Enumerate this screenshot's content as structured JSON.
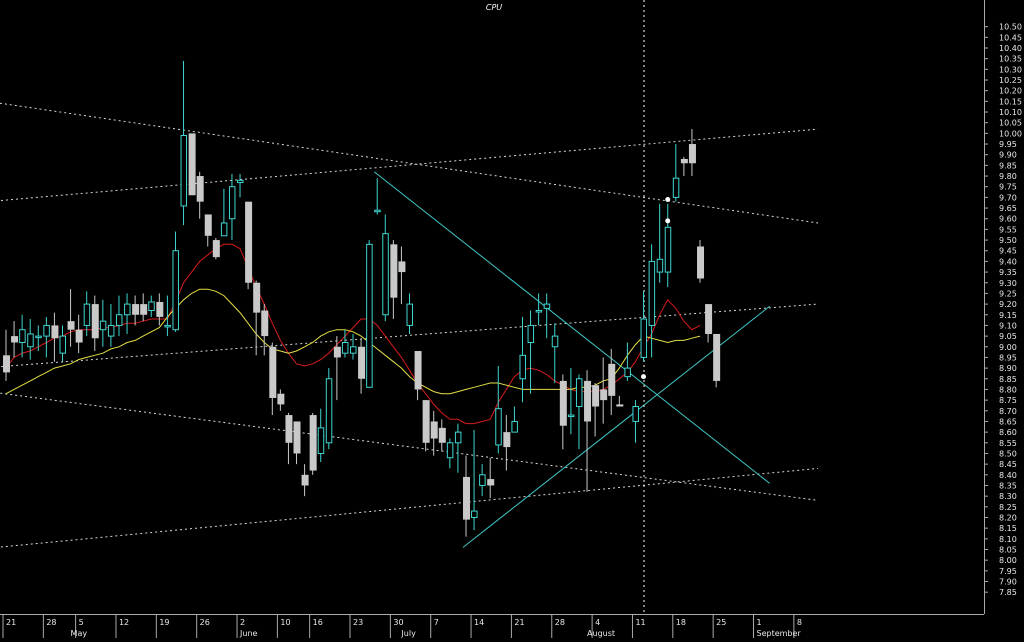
{
  "chart_data": {
    "type": "candlestick",
    "title": "CPU",
    "xlabel": "",
    "ylabel": "",
    "ylim": [
      7.8,
      10.55
    ],
    "y_ticks": [
      "7.85",
      "7.90",
      "7.95",
      "8.00",
      "8.05",
      "8.10",
      "8.15",
      "8.20",
      "8.25",
      "8.30",
      "8.35",
      "8.40",
      "8.45",
      "8.50",
      "8.55",
      "8.60",
      "8.65",
      "8.70",
      "8.75",
      "8.80",
      "8.85",
      "8.90",
      "8.95",
      "9.00",
      "9.05",
      "9.10",
      "9.15",
      "9.20",
      "9.25",
      "9.30",
      "9.35",
      "9.40",
      "9.45",
      "9.50",
      "9.55",
      "9.60",
      "9.65",
      "9.70",
      "9.75",
      "9.80",
      "9.85",
      "9.90",
      "9.95",
      "10.00",
      "10.05",
      "10.10",
      "10.15",
      "10.20",
      "10.25",
      "10.30",
      "10.35",
      "10.40",
      "10.45",
      "10.50"
    ],
    "x_day_ticks": [
      {
        "i": 0,
        "label": "21"
      },
      {
        "i": 5,
        "label": "28"
      },
      {
        "i": 9,
        "label": "5"
      },
      {
        "i": 14,
        "label": "12"
      },
      {
        "i": 19,
        "label": "19"
      },
      {
        "i": 24,
        "label": "26"
      },
      {
        "i": 29,
        "label": "2"
      },
      {
        "i": 34,
        "label": "10"
      },
      {
        "i": 38,
        "label": "16"
      },
      {
        "i": 43,
        "label": "23"
      },
      {
        "i": 48,
        "label": "30"
      },
      {
        "i": 53,
        "label": "7"
      },
      {
        "i": 58,
        "label": "14"
      },
      {
        "i": 63,
        "label": "21"
      },
      {
        "i": 68,
        "label": "28"
      },
      {
        "i": 73,
        "label": "4"
      },
      {
        "i": 78,
        "label": "11"
      },
      {
        "i": 83,
        "label": "18"
      },
      {
        "i": 88,
        "label": "25"
      },
      {
        "i": 93,
        "label": "1"
      },
      {
        "i": 98,
        "label": "8"
      }
    ],
    "x_month_ticks": [
      {
        "i": 8,
        "label": "May"
      },
      {
        "i": 29,
        "label": "June"
      },
      {
        "i": 49,
        "label": "July"
      },
      {
        "i": 72,
        "label": "August"
      },
      {
        "i": 93,
        "label": "September"
      }
    ],
    "cursor_index": 79,
    "candles": [
      [
        8.96,
        8.88,
        9.08,
        8.84
      ],
      [
        9.05,
        9.02,
        9.12,
        8.95
      ],
      [
        9.02,
        9.08,
        9.15,
        8.95
      ],
      [
        9.0,
        9.06,
        9.13,
        8.94
      ],
      [
        9.05,
        9.05,
        9.1,
        8.98
      ],
      [
        9.05,
        9.1,
        9.14,
        8.95
      ],
      [
        9.1,
        9.04,
        9.16,
        8.93
      ],
      [
        8.97,
        9.05,
        9.1,
        8.93
      ],
      [
        9.12,
        9.08,
        9.27,
        9.0
      ],
      [
        9.08,
        9.02,
        9.15,
        8.97
      ],
      [
        9.1,
        9.2,
        9.26,
        9.05
      ],
      [
        9.2,
        9.04,
        9.24,
        8.98
      ],
      [
        9.08,
        9.12,
        9.22,
        9.0
      ],
      [
        9.05,
        9.1,
        9.2,
        9.0
      ],
      [
        9.1,
        9.15,
        9.24,
        9.05
      ],
      [
        9.15,
        9.2,
        9.25,
        9.06
      ],
      [
        9.2,
        9.15,
        9.24,
        9.1
      ],
      [
        9.2,
        9.15,
        9.25,
        9.12
      ],
      [
        9.17,
        9.21,
        9.24,
        9.14
      ],
      [
        9.21,
        9.14,
        9.25,
        9.1
      ],
      [
        9.1,
        9.1,
        9.24,
        9.05
      ],
      [
        9.08,
        9.45,
        9.54,
        9.07
      ],
      [
        9.66,
        9.99,
        10.34,
        9.57
      ],
      [
        10.0,
        9.71,
        9.99,
        9.72
      ],
      [
        9.8,
        9.68,
        9.82,
        9.6
      ],
      [
        9.62,
        9.52,
        9.62,
        9.47
      ],
      [
        9.5,
        9.42,
        9.51,
        9.41
      ],
      [
        9.52,
        9.58,
        9.74,
        9.52
      ],
      [
        9.6,
        9.75,
        9.81,
        9.5
      ],
      [
        9.77,
        9.78,
        9.81,
        9.7
      ],
      [
        9.68,
        9.3,
        9.67,
        9.27
      ],
      [
        9.3,
        9.16,
        9.31,
        8.96
      ],
      [
        9.17,
        9.05,
        9.2,
        8.96
      ],
      [
        9.0,
        8.76,
        9.02,
        8.68
      ],
      [
        8.78,
        8.73,
        8.8,
        8.7
      ],
      [
        8.68,
        8.55,
        8.69,
        8.45
      ],
      [
        8.65,
        8.5,
        8.65,
        8.45
      ],
      [
        8.4,
        8.35,
        8.45,
        8.3
      ],
      [
        8.68,
        8.42,
        8.69,
        8.4
      ],
      [
        8.5,
        8.62,
        8.71,
        8.46
      ],
      [
        8.55,
        8.85,
        8.9,
        8.52
      ],
      [
        9.0,
        8.95,
        9.05,
        8.75
      ],
      [
        8.97,
        9.02,
        9.08,
        8.95
      ],
      [
        8.97,
        9.0,
        9.06,
        8.94
      ],
      [
        9.0,
        8.85,
        9.04,
        8.78
      ],
      [
        8.81,
        9.48,
        9.5,
        8.9
      ],
      [
        9.64,
        9.64,
        9.79,
        9.62
      ],
      [
        9.15,
        9.53,
        9.62,
        9.12
      ],
      [
        9.48,
        9.23,
        9.5,
        9.13
      ],
      [
        9.4,
        9.35,
        9.47,
        9.2
      ],
      [
        9.1,
        9.2,
        9.25,
        9.06
      ],
      [
        8.98,
        8.8,
        8.97,
        8.75
      ],
      [
        8.75,
        8.55,
        8.75,
        8.51
      ],
      [
        8.65,
        8.57,
        8.7,
        8.49
      ],
      [
        8.62,
        8.55,
        8.66,
        8.51
      ],
      [
        8.48,
        8.55,
        8.57,
        8.43
      ],
      [
        8.55,
        8.6,
        8.64,
        8.41
      ],
      [
        8.39,
        8.19,
        8.49,
        8.11
      ],
      [
        8.2,
        8.23,
        8.61,
        8.14
      ],
      [
        8.35,
        8.4,
        8.45,
        8.3
      ],
      [
        8.38,
        8.35,
        8.48,
        8.29
      ],
      [
        8.54,
        8.71,
        8.91,
        8.5
      ],
      [
        8.6,
        8.53,
        8.68,
        8.42
      ],
      [
        8.6,
        8.65,
        8.72,
        8.6
      ],
      [
        8.85,
        8.96,
        9.14,
        8.74
      ],
      [
        9.02,
        9.1,
        9.17,
        8.78
      ],
      [
        9.17,
        9.17,
        9.25,
        9.1
      ],
      [
        9.18,
        9.2,
        9.25,
        9.04
      ],
      [
        9.0,
        9.05,
        9.11,
        8.83
      ],
      [
        8.84,
        8.63,
        8.87,
        8.52
      ],
      [
        8.68,
        8.68,
        8.9,
        8.59
      ],
      [
        8.72,
        8.85,
        8.87,
        8.52
      ],
      [
        8.84,
        8.65,
        8.89,
        8.32
      ],
      [
        8.82,
        8.72,
        8.83,
        8.58
      ],
      [
        8.8,
        8.75,
        8.95,
        8.64
      ],
      [
        8.92,
        8.77,
        8.99,
        8.68
      ],
      [
        8.73,
        8.72,
        8.77,
        8.72
      ],
      [
        8.86,
        8.9,
        9.02,
        8.84
      ],
      [
        8.65,
        8.72,
        8.75,
        8.55
      ],
      [
        8.95,
        9.13,
        9.26,
        8.93
      ],
      [
        9.1,
        9.4,
        9.48,
        8.95
      ],
      [
        9.35,
        9.41,
        9.67,
        9.3
      ],
      [
        9.35,
        9.56,
        9.67,
        9.28
      ],
      [
        9.7,
        9.79,
        9.95,
        9.68
      ],
      [
        9.88,
        9.86,
        9.89,
        9.8
      ],
      [
        9.95,
        9.86,
        10.02,
        9.8
      ],
      [
        9.47,
        9.32,
        9.5,
        9.3
      ],
      [
        9.2,
        9.06,
        9.19,
        9.02
      ],
      [
        9.06,
        8.84,
        9.05,
        8.81
      ]
    ],
    "series": [
      {
        "name": "",
        "color": "#d81c1c",
        "values": [
          8.9,
          8.95,
          8.97,
          8.98,
          9.0,
          9.02,
          9.04,
          9.05,
          9.07,
          9.08,
          9.08,
          9.08,
          9.09,
          9.09,
          9.1,
          9.11,
          9.11,
          9.12,
          9.13,
          9.13,
          9.13,
          9.21,
          9.3,
          9.35,
          9.4,
          9.43,
          9.46,
          9.48,
          9.48,
          9.46,
          9.37,
          9.28,
          9.2,
          9.11,
          9.03,
          8.97,
          8.92,
          8.91,
          8.92,
          8.94,
          8.97,
          9.01,
          9.05,
          9.09,
          9.13,
          9.13,
          9.1,
          9.05,
          9.0,
          8.95,
          8.89,
          8.83,
          8.78,
          8.73,
          8.69,
          8.66,
          8.66,
          8.64,
          8.64,
          8.65,
          8.66,
          8.74,
          8.8,
          8.86,
          8.89,
          8.9,
          8.89,
          8.87,
          8.84,
          8.82,
          8.8,
          8.79,
          8.79,
          8.79,
          8.8,
          8.82,
          8.85,
          8.88,
          8.93,
          9.0,
          9.06,
          9.15,
          9.22,
          9.18,
          9.12,
          9.08,
          9.1
        ]
      },
      {
        "name": "",
        "color": "#e5df44",
        "values": [
          8.78,
          8.8,
          8.82,
          8.84,
          8.86,
          8.88,
          8.9,
          8.91,
          8.92,
          8.94,
          8.95,
          8.96,
          8.97,
          8.99,
          9.0,
          9.02,
          9.03,
          9.05,
          9.07,
          9.09,
          9.14,
          9.18,
          9.22,
          9.25,
          9.27,
          9.27,
          9.26,
          9.24,
          9.2,
          9.16,
          9.11,
          9.06,
          9.02,
          8.99,
          8.98,
          8.97,
          8.98,
          9.0,
          9.02,
          9.05,
          9.07,
          9.08,
          9.08,
          9.07,
          9.05,
          9.02,
          8.99,
          8.96,
          8.93,
          8.9,
          8.86,
          8.83,
          8.81,
          8.79,
          8.78,
          8.78,
          8.79,
          8.8,
          8.81,
          8.82,
          8.83,
          8.83,
          8.82,
          8.81,
          8.8,
          8.8,
          8.8,
          8.8,
          8.8,
          8.8,
          8.8,
          8.81,
          8.81,
          8.82,
          8.84,
          8.85,
          8.9,
          8.96,
          9.01,
          9.05,
          9.04,
          9.03,
          9.02,
          9.03,
          9.03,
          9.04,
          9.05
        ]
      }
    ],
    "trendlines": [
      {
        "color": "#d8d8d8",
        "dashed": true,
        "from": [
          -20,
          10.25
        ],
        "to": [
          101,
          9.58
        ]
      },
      {
        "color": "#d8d8d8",
        "dashed": true,
        "from": [
          -20,
          9.62
        ],
        "to": [
          101,
          10.02
        ]
      },
      {
        "color": "#d8d8d8",
        "dashed": true,
        "from": [
          -20,
          8.85
        ],
        "to": [
          101,
          9.2
        ]
      },
      {
        "color": "#d8d8d8",
        "dashed": true,
        "from": [
          -20,
          8.88
        ],
        "to": [
          101,
          8.28
        ]
      },
      {
        "color": "#d8d8d8",
        "dashed": true,
        "from": [
          -20,
          7.99
        ],
        "to": [
          101,
          8.43
        ]
      },
      {
        "color": "#3fc6c6",
        "dashed": false,
        "from": [
          46,
          9.82
        ],
        "to": [
          95,
          8.36
        ]
      },
      {
        "color": "#3fc6c6",
        "dashed": false,
        "from": [
          57,
          8.06
        ],
        "to": [
          95,
          9.19
        ]
      }
    ],
    "markers": [
      [
        79,
        8.86
      ],
      [
        82,
        9.69
      ],
      [
        82,
        9.59
      ]
    ],
    "candle_color": "#c9c9c9",
    "highlight_color": "#3fd6d0",
    "grid": false,
    "legend": "none"
  }
}
